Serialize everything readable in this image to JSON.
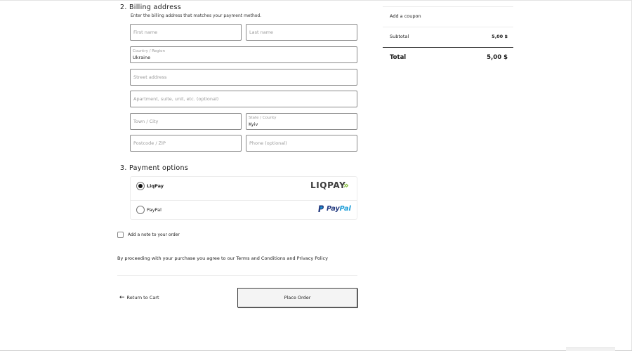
{
  "billing": {
    "title": "2.  Billing address",
    "description": "Enter the billing address that matches your payment method.",
    "first_name_placeholder": "First name",
    "last_name_placeholder": "Last name",
    "country_label": "Country / Region",
    "country_value": "Ukraine",
    "street_placeholder": "Street address",
    "apartment_placeholder": "Apartment, suite, unit, etc. (optional)",
    "town_placeholder": "Town / City",
    "state_label": "State / County",
    "state_value": "Kyiv",
    "postcode_placeholder": "Postcode / ZIP",
    "phone_placeholder": "Phone (optional)"
  },
  "payment": {
    "title": "3.  Payment options",
    "options": [
      {
        "label": "LiqPay",
        "selected": true,
        "logo_text": "LIQPAY",
        "logo_arrows": "»"
      },
      {
        "label": "PayPal",
        "selected": false,
        "logo_part1": "Pay",
        "logo_part2": "Pal"
      }
    ]
  },
  "note_label": "Add a note to your order",
  "terms": "By proceeding with your purchase you agree to our Terms and Conditions and Privacy Policy",
  "actions": {
    "return_label": "Return to Cart",
    "place_order_label": "Place Order"
  },
  "summary": {
    "coupon_label": "Add a coupon",
    "subtotal_label": "Subtotal",
    "subtotal_value": "5,00 $",
    "total_label": "Total",
    "total_value": "5,00 $"
  },
  "colors": {
    "liqpay_green": "#7ab72b",
    "paypal_dark": "#253b80",
    "paypal_light": "#179bd7"
  },
  "icons": [
    "arrow-left-icon",
    "paypal-icon"
  ]
}
